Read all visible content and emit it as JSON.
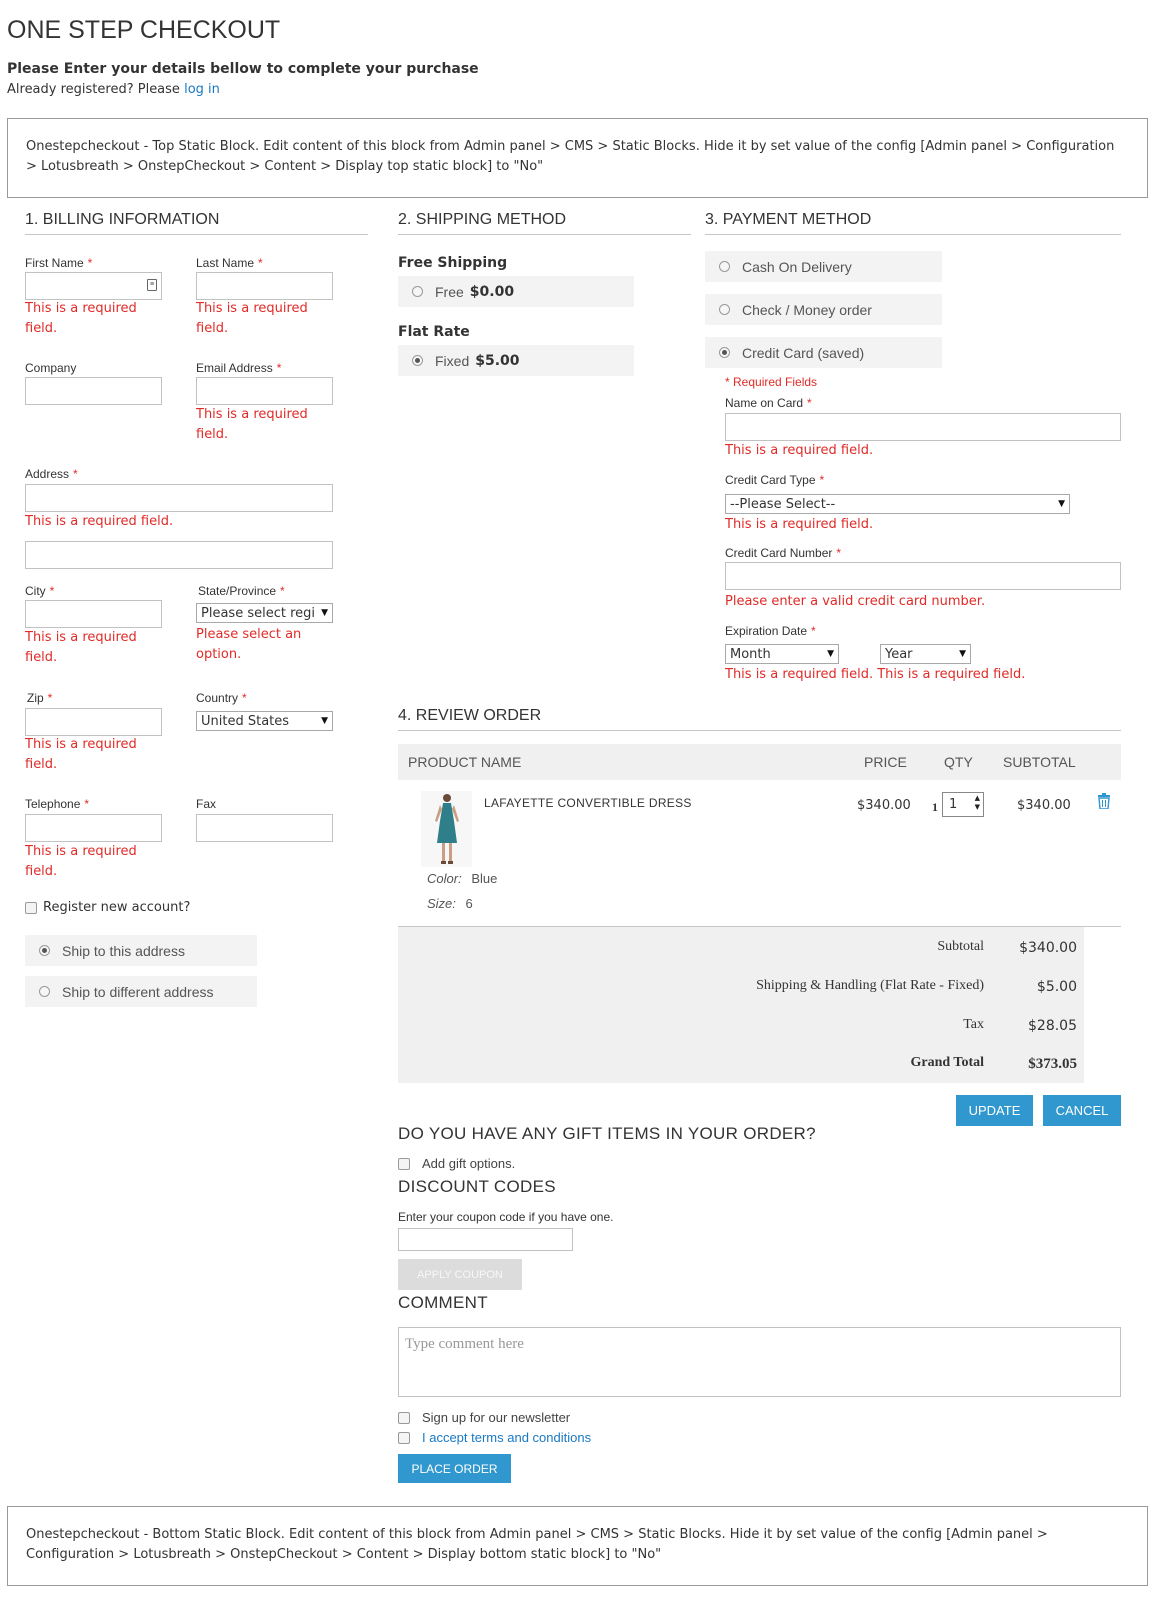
{
  "page": {
    "title": "ONE STEP CHECKOUT",
    "intro": "Please Enter your details bellow to complete your purchase",
    "already_registered": "Already registered? Please",
    "login_link": "log in"
  },
  "static_top": "Onestepcheckout - Top Static Block. Edit content of this block from Admin panel > CMS > Static Blocks. Hide it by set value of the config [Admin panel > Configuration > Lotusbreath > OnstepCheckout > Content > Display top static block] to \"No\"",
  "static_bottom": "Onestepcheckout - Bottom Static Block. Edit content of this block from Admin panel > CMS > Static Blocks. Hide it by set value of the config [Admin panel > Configuration > Lotusbreath > OnstepCheckout > Content > Display bottom static block] to \"No\"",
  "billing": {
    "title": "1. BILLING INFORMATION",
    "first_name": "First Name",
    "last_name": "Last Name",
    "company": "Company",
    "email": "Email Address",
    "address": "Address",
    "city": "City",
    "state": "State/Province",
    "state_placeholder": "Please select regi",
    "zip": "Zip",
    "country": "Country",
    "country_value": "United States",
    "telephone": "Telephone",
    "fax": "Fax",
    "required_asterisk": "*",
    "error_required_l1": "This is a required",
    "error_required_l2": "field.",
    "error_required_full": "This is a required field.",
    "error_select_l1": "Please select an",
    "error_select_l2": "option.",
    "register": "Register new account?",
    "ship_this": "Ship to this address",
    "ship_different": "Ship to different address"
  },
  "shipping": {
    "title": "2. SHIPPING METHOD",
    "free_heading": "Free Shipping",
    "free_label": "Free",
    "free_price": "$0.00",
    "flat_heading": "Flat Rate",
    "flat_label": "Fixed",
    "flat_price": "$5.00"
  },
  "payment": {
    "title": "3. PAYMENT METHOD",
    "cod": "Cash On Delivery",
    "check": "Check / Money order",
    "cc": "Credit Card (saved)",
    "required_fields": "* Required Fields",
    "name_on_card": "Name on Card",
    "cc_type": "Credit Card Type",
    "cc_type_value": "--Please Select--",
    "cc_number": "Credit Card Number",
    "cc_number_error": "Please enter a valid credit card number.",
    "exp_date": "Expiration Date",
    "month": "Month",
    "year": "Year",
    "exp_error": "This is a required field. This is a required field."
  },
  "review": {
    "title": "4. REVIEW ORDER",
    "col_product": "PRODUCT NAME",
    "col_price": "PRICE",
    "col_qty": "QTY",
    "col_subtotal": "SUBTOTAL",
    "item": {
      "name": "LAFAYETTE CONVERTIBLE DRESS",
      "price": "$340.00",
      "qty_label": "1",
      "qty_value": "1",
      "subtotal": "$340.00",
      "color_label": "Color:",
      "color_value": "Blue",
      "size_label": "Size:",
      "size_value": "6"
    },
    "subtotal_label": "Subtotal",
    "subtotal_value": "$340.00",
    "shipping_label": "Shipping & Handling (Flat Rate - Fixed)",
    "shipping_value": "$5.00",
    "tax_label": "Tax",
    "tax_value": "$28.05",
    "grand_label": "Grand Total",
    "grand_value": "$373.05",
    "update_btn": "UPDATE",
    "cancel_btn": "CANCEL"
  },
  "gift": {
    "title": "DO YOU HAVE ANY GIFT ITEMS IN YOUR ORDER?",
    "add": "Add gift options."
  },
  "discount": {
    "title": "DISCOUNT CODES",
    "hint": "Enter your coupon code if you have one.",
    "apply": "APPLY COUPON"
  },
  "comment": {
    "title": "COMMENT",
    "placeholder": "Type comment here"
  },
  "footer_opts": {
    "newsletter": "Sign up for our newsletter",
    "terms": "I accept terms and conditions",
    "place_order": "PLACE ORDER"
  },
  "colors": {
    "accent": "#3098cf",
    "error": "#e02b27",
    "link": "#1979c3"
  }
}
